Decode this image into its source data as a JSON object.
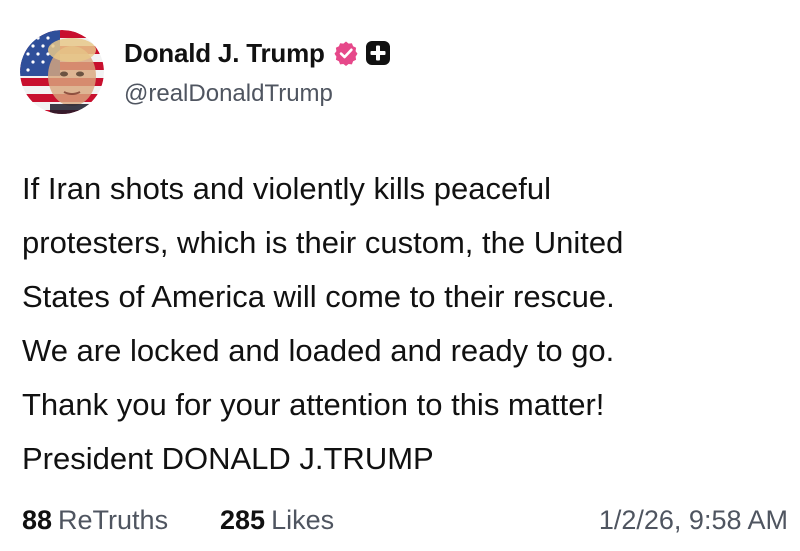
{
  "author": {
    "display_name": "Donald J. Trump",
    "handle": "@realDonaldTrump",
    "verified_badge_color": "#e6488a",
    "avatar": "avatar-photo"
  },
  "post": {
    "lines": [
      "If Iran shots and violently kills peaceful",
      "protesters, which is their custom, the United",
      "States of America will come to their rescue.",
      "We are locked and loaded and ready to go.",
      "Thank you for your attention to this matter!",
      "President DONALD J.TRUMP"
    ]
  },
  "stats": {
    "retruths_count": "88",
    "retruths_label": "ReTruths",
    "likes_count": "285",
    "likes_label": "Likes"
  },
  "timestamp": "1/2/26, 9:58 AM",
  "icons": {
    "verified": "verified-badge-icon",
    "plus": "plus-badge-icon"
  }
}
